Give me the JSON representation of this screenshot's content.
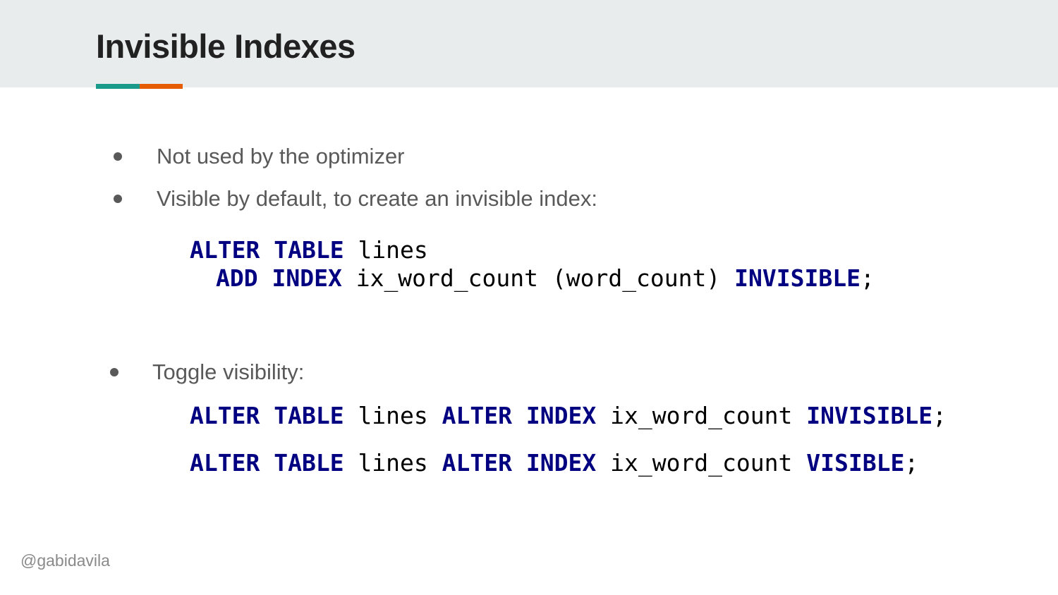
{
  "slide": {
    "title": "Invisible Indexes",
    "accent_colors": [
      "#1a9a8a",
      "#e65c00"
    ]
  },
  "bullets": [
    {
      "text": "Not used by the optimizer"
    },
    {
      "text": "Visible by default, to create an invisible index:"
    },
    {
      "text": "Toggle visibility:"
    }
  ],
  "code_create": {
    "line1": {
      "kw1": "ALTER",
      "kw2": "TABLE",
      "table": "lines"
    },
    "line2": {
      "kw1": "ADD",
      "kw2": "INDEX",
      "rest": "ix_word_count (word_count)",
      "kw3": "INVISIBLE",
      "end": ";"
    }
  },
  "code_toggle": [
    {
      "kw1": "ALTER",
      "kw2": "TABLE",
      "table": "lines",
      "kw3": "ALTER",
      "kw4": "INDEX",
      "index": "ix_word_count",
      "kw5": "INVISIBLE",
      "end": ";"
    },
    {
      "kw1": "ALTER",
      "kw2": "TABLE",
      "table": "lines",
      "kw3": "ALTER",
      "kw4": "INDEX",
      "index": "ix_word_count",
      "kw5": "VISIBLE",
      "end": ";"
    }
  ],
  "footer": {
    "handle": "@gabidavila"
  },
  "colors": {
    "keyword": "#000080",
    "bullet_text": "#595959",
    "header_bg": "#e8ecec"
  }
}
